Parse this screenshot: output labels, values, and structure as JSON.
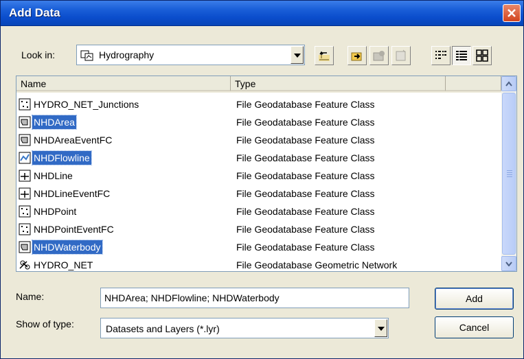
{
  "window": {
    "title": "Add Data"
  },
  "lookin": {
    "label": "Look in:",
    "value": "Hydrography"
  },
  "list": {
    "columns": [
      "Name",
      "Type",
      ""
    ],
    "rows": [
      {
        "name": "HYDRO_NET_Junctions",
        "type": "File Geodatabase Feature Class",
        "icon": "point-featureclass-icon",
        "selected": false
      },
      {
        "name": "NHDArea",
        "type": "File Geodatabase Feature Class",
        "icon": "polygon-featureclass-icon",
        "selected": true
      },
      {
        "name": "NHDAreaEventFC",
        "type": "File Geodatabase Feature Class",
        "icon": "polygon-featureclass-icon",
        "selected": false
      },
      {
        "name": "NHDFlowline",
        "type": "File Geodatabase Feature Class",
        "icon": "network-line-featureclass-icon",
        "selected": true
      },
      {
        "name": "NHDLine",
        "type": "File Geodatabase Feature Class",
        "icon": "line-featureclass-icon",
        "selected": false
      },
      {
        "name": "NHDLineEventFC",
        "type": "File Geodatabase Feature Class",
        "icon": "line-featureclass-icon",
        "selected": false
      },
      {
        "name": "NHDPoint",
        "type": "File Geodatabase Feature Class",
        "icon": "point-featureclass-icon",
        "selected": false
      },
      {
        "name": "NHDPointEventFC",
        "type": "File Geodatabase Feature Class",
        "icon": "point-featureclass-icon",
        "selected": false
      },
      {
        "name": "NHDWaterbody",
        "type": "File Geodatabase Feature Class",
        "icon": "polygon-featureclass-icon",
        "selected": true
      },
      {
        "name": "HYDRO_NET",
        "type": "File Geodatabase Geometric Network",
        "icon": "geometric-network-icon",
        "selected": false
      }
    ]
  },
  "name_field": {
    "label": "Name:",
    "value": "NHDArea; NHDFlowline; NHDWaterbody"
  },
  "type_field": {
    "label": "Show of type:",
    "value": "Datasets and Layers (*.lyr)"
  },
  "buttons": {
    "add": "Add",
    "cancel": "Cancel"
  },
  "colors": {
    "selection": "#316ac5",
    "titlebar": "#0a4ccb",
    "dialog_bg": "#ece9d8"
  }
}
